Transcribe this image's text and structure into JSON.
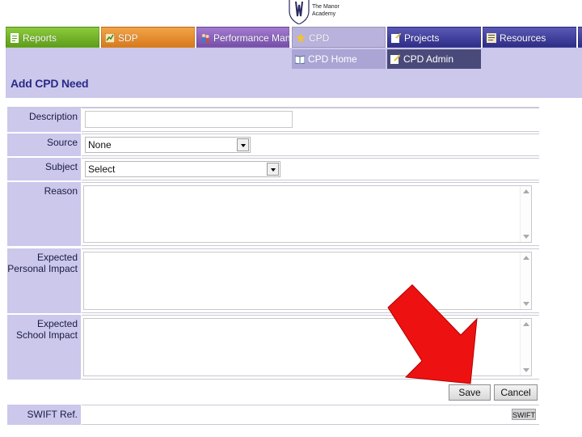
{
  "logo": {
    "line1": "The Manor",
    "line2": "Academy"
  },
  "nav": {
    "tabs": [
      {
        "label": "Reports",
        "icon": "reports-icon"
      },
      {
        "label": "SDP",
        "icon": "sdp-icon"
      },
      {
        "label": "Performance Man.",
        "icon": "people-icon"
      },
      {
        "label": "CPD",
        "icon": "star-icon",
        "active": true
      },
      {
        "label": "Projects",
        "icon": "projects-icon"
      },
      {
        "label": "Resources",
        "icon": "resources-icon"
      }
    ],
    "subtabs": [
      {
        "label": "CPD Home",
        "icon": "book-icon"
      },
      {
        "label": "CPD Admin",
        "icon": "admin-icon"
      }
    ]
  },
  "page": {
    "title": "Add CPD Need"
  },
  "form": {
    "description": {
      "label": "Description",
      "value": ""
    },
    "source": {
      "label": "Source",
      "value": "None"
    },
    "subject": {
      "label": "Subject",
      "value": "Select"
    },
    "reason": {
      "label": "Reason",
      "value": ""
    },
    "personal_impact": {
      "label_line1": "Expected",
      "label_line2": "Personal Impact",
      "value": ""
    },
    "school_impact": {
      "label_line1": "Expected",
      "label_line2": "School Impact",
      "value": ""
    },
    "buttons": {
      "save": "Save",
      "cancel": "Cancel"
    },
    "swift": {
      "label": "SWIFT Ref.",
      "button": "SWIFT"
    }
  },
  "colors": {
    "band": "#cbc8ec",
    "title": "#2a2a88",
    "reports_tab": "#6fb226",
    "sdp_tab": "#e88b2c",
    "performance_tab": "#8a62bd",
    "cpd_tab": "#b8b2dc",
    "projects_tab": "#3e3d9a",
    "annotation_arrow": "#ee1111"
  },
  "annotation": {
    "type": "arrow",
    "points_to": "save-button"
  }
}
